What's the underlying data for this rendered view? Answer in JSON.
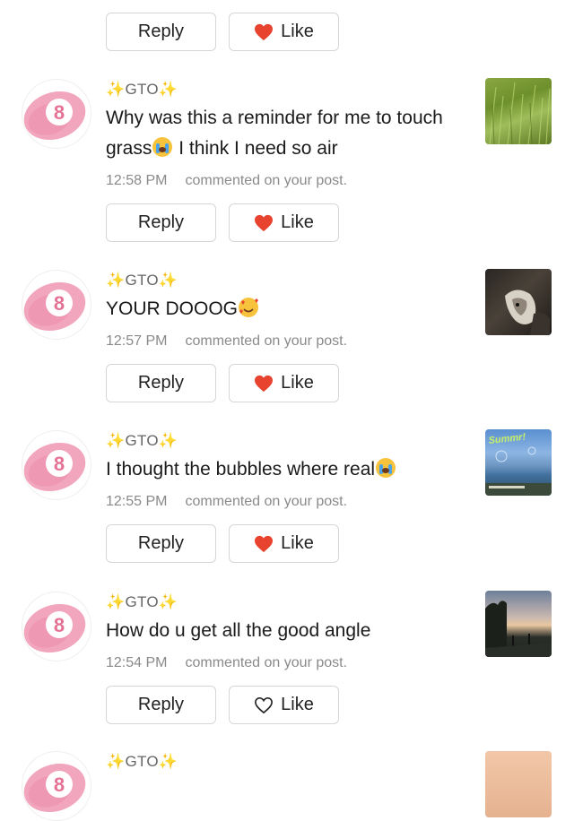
{
  "colors": {
    "heart": "#e8432f",
    "sparkle": "#e8b93a",
    "meta": "#8a8a8a",
    "border": "#d6d6d6"
  },
  "buttons": {
    "reply_label": "Reply",
    "like_label": "Like"
  },
  "comments": [
    {
      "user": "GTO",
      "sparkle": "✨",
      "text_a": "Why was this a reminder for me to touch",
      "text_b": "grass",
      "text_c": " I think I need so air",
      "text_emoji": "crying-face-icon",
      "time": "12:58 PM",
      "action": "commented on your post.",
      "liked": true,
      "thumb": "grass-photo"
    },
    {
      "user": "GTO",
      "sparkle": "✨",
      "text_a": "YOUR DOOOG",
      "text_emoji": "smiling-face-with-hearts-icon",
      "time": "12:57 PM",
      "action": "commented on your post.",
      "liked": true,
      "thumb": "dog-photo"
    },
    {
      "user": "GTO",
      "sparkle": "✨",
      "text_a": "I thought the bubbles where real",
      "text_emoji": "crying-face-icon",
      "time": "12:55 PM",
      "action": "commented on your post.",
      "liked": true,
      "thumb": "beach-photo",
      "thumb_caption": "Summr!"
    },
    {
      "user": "GTO",
      "sparkle": "✨",
      "text_a": "How do u get all the good angle",
      "time": "12:54 PM",
      "action": "commented on your post.",
      "liked": false,
      "thumb": "sunset-photo"
    },
    {
      "user": "GTO",
      "sparkle": "✨",
      "thumb": "skin-photo"
    }
  ]
}
